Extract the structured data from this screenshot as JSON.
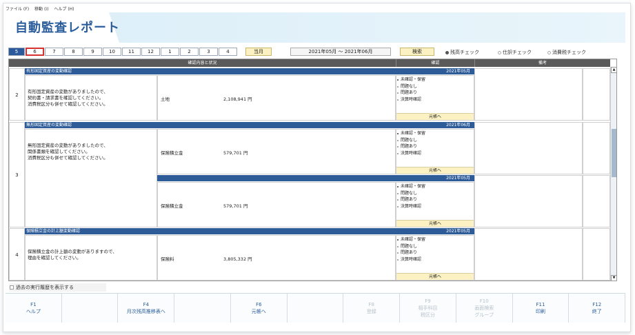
{
  "menu": [
    "ファイル (F)",
    "移動 (I)",
    "ヘルプ (H)"
  ],
  "title": "自動監査レポート",
  "months": [
    "5",
    "6",
    "7",
    "8",
    "9",
    "10",
    "11",
    "12",
    "1",
    "2",
    "3",
    "4"
  ],
  "selected_month": "6",
  "btn_current": "当月",
  "period": "2021年05月 ～ 2021年06月",
  "btn_search": "検索",
  "checks": [
    {
      "label": "残高チェック",
      "on": true
    },
    {
      "label": "仕訳チェック",
      "on": false
    },
    {
      "label": "消費税チェック",
      "on": false
    }
  ],
  "headers": {
    "content": "確認内容と状況",
    "confirm": "確認",
    "note": "備考"
  },
  "status_options": [
    "未確認・保留",
    "問題なし",
    "問題あり",
    "決算時確認"
  ],
  "to_ledger": "元帳へ",
  "sections": [
    {
      "num": "2",
      "title": "有形固定資産の変動確認",
      "month": "2021年05月",
      "desc": [
        "有形固定資産の変動がありましたので、",
        "契約書・請求書を確認してください。",
        "消費税区分も併せて確認してください。"
      ],
      "account": "土地",
      "amount": "2,108,941 円"
    },
    {
      "num": "3",
      "title": "無形固定資産の変動確認",
      "month": "2021年06月",
      "desc": [
        "無形固定資産の変動がありましたので、",
        "関係書類を確認してください。",
        "消費税区分も併せて確認してください。"
      ],
      "account": "保険積立金",
      "amount": "579,701 円",
      "sub": {
        "month": "2021年05月",
        "account": "保険積立金",
        "amount": "579,701 円"
      }
    },
    {
      "num": "4",
      "title": "保険積立金の計上額変動確認",
      "month": "2021年05月",
      "desc": [
        "保険積立金の計上額の変動がありますので、",
        "理由を確認してください。"
      ],
      "account": "保険料",
      "amount": "3,805,332 円"
    }
  ],
  "history_label": "過去の実行履歴を表示する",
  "fkeys": [
    {
      "k": "F1",
      "l": "ヘルプ",
      "dis": false
    },
    {
      "k": "",
      "l": "",
      "dis": false
    },
    {
      "k": "F4",
      "l": "月次残高推移表へ",
      "dis": false
    },
    {
      "k": "",
      "l": "",
      "dis": false
    },
    {
      "k": "F6",
      "l": "元帳へ",
      "dis": false
    },
    {
      "k": "",
      "l": "",
      "dis": false
    },
    {
      "k": "F8",
      "l": "登録",
      "dis": true
    },
    {
      "k": "F9",
      "l": "相手科目 / 税区分",
      "dis": true
    },
    {
      "k": "F10",
      "l": "画面検索 / グループ",
      "dis": true
    },
    {
      "k": "F11",
      "l": "印刷",
      "dis": false
    },
    {
      "k": "F12",
      "l": "終了",
      "dis": false
    }
  ]
}
